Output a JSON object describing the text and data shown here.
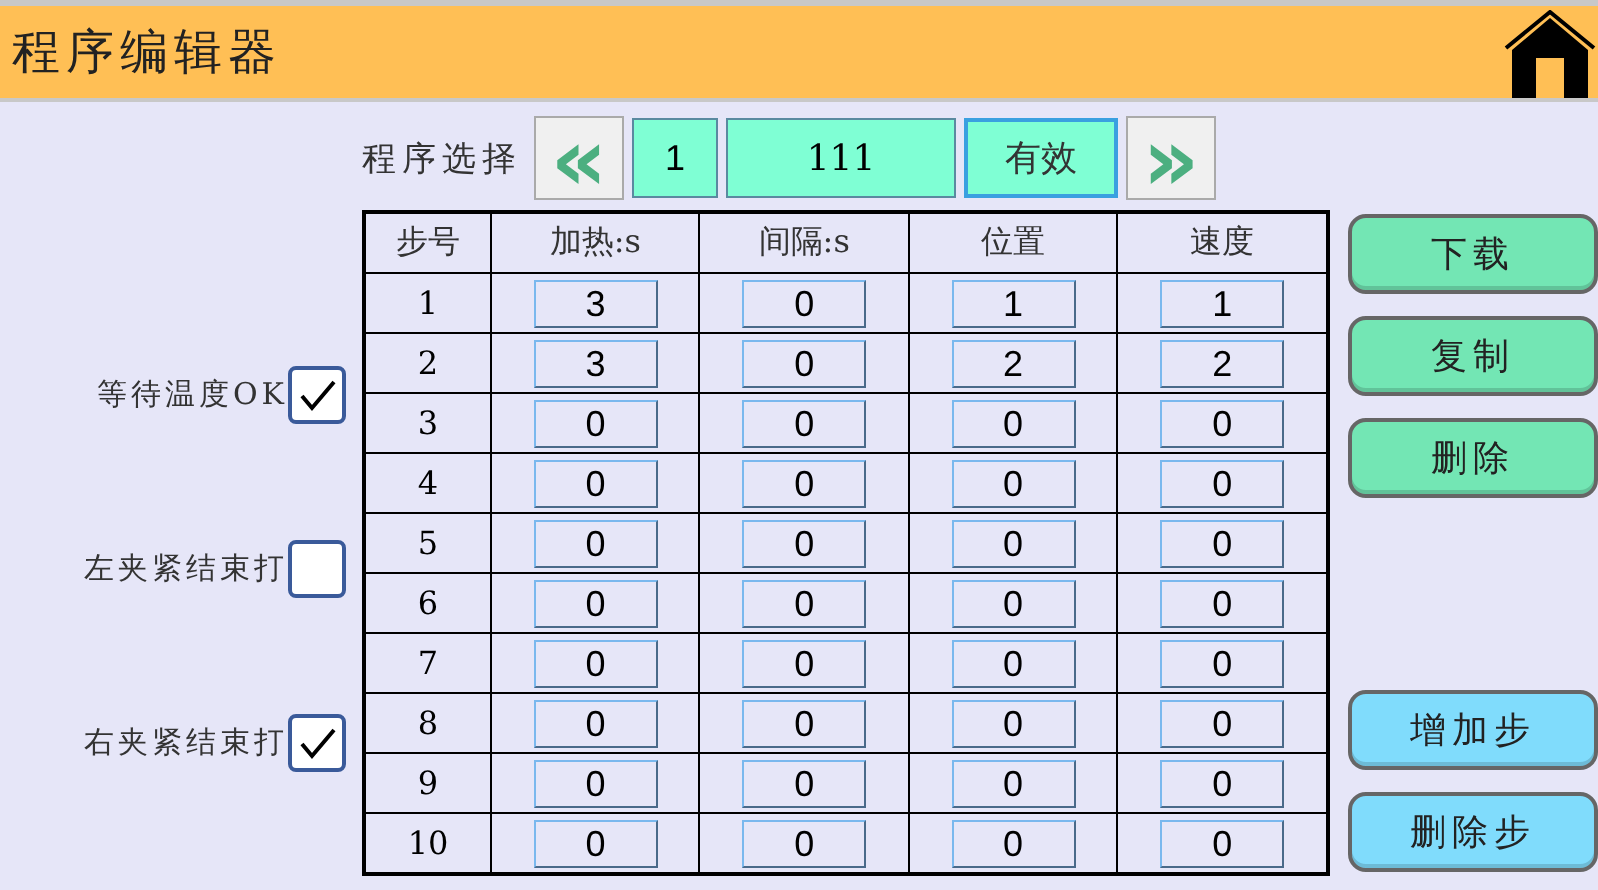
{
  "window": {
    "title": "程序编辑器"
  },
  "program_select": {
    "label": "程序选择",
    "prev": "«",
    "number": "1",
    "name": "111",
    "status": "有效",
    "next": "»"
  },
  "options": [
    {
      "label": "等待温度OK",
      "checked": true
    },
    {
      "label": "左夹紧结束打",
      "checked": false
    },
    {
      "label": "右夹紧结束打",
      "checked": true
    }
  ],
  "table": {
    "columns": [
      "步号",
      "加热:s",
      "间隔:s",
      "位置",
      "速度"
    ],
    "rows": [
      [
        "1",
        "3",
        "0",
        "1",
        "1"
      ],
      [
        "2",
        "3",
        "0",
        "2",
        "2"
      ],
      [
        "3",
        "0",
        "0",
        "0",
        "0"
      ],
      [
        "4",
        "0",
        "0",
        "0",
        "0"
      ],
      [
        "5",
        "0",
        "0",
        "0",
        "0"
      ],
      [
        "6",
        "0",
        "0",
        "0",
        "0"
      ],
      [
        "7",
        "0",
        "0",
        "0",
        "0"
      ],
      [
        "8",
        "0",
        "0",
        "0",
        "0"
      ],
      [
        "9",
        "0",
        "0",
        "0",
        "0"
      ],
      [
        "10",
        "0",
        "0",
        "0",
        "0"
      ]
    ]
  },
  "action_buttons": [
    "下载",
    "复制",
    "删除"
  ],
  "step_buttons": [
    "增加步",
    "删除步"
  ]
}
